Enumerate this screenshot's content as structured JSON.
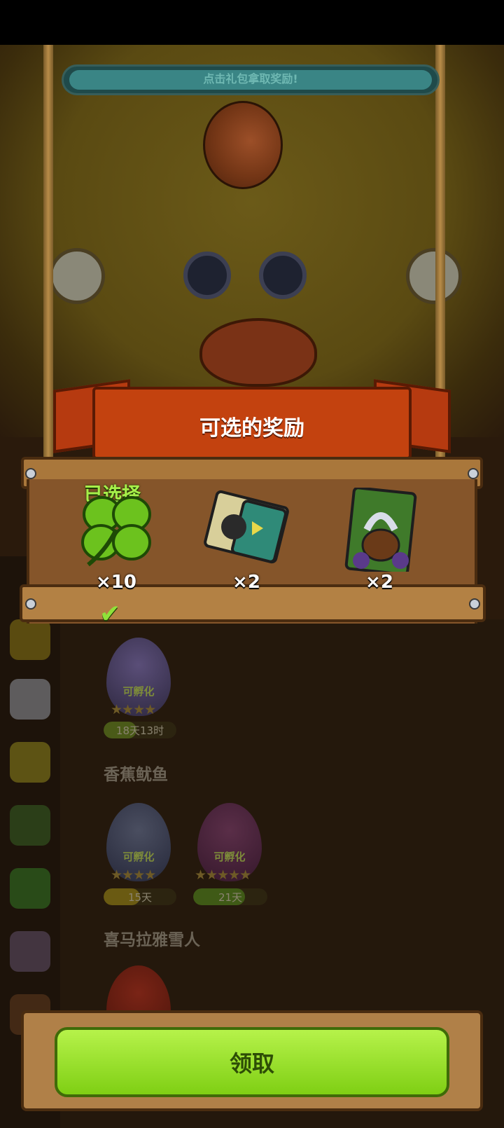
{
  "top_banner": {
    "text": "点击礼包拿取奖励!"
  },
  "panel": {
    "title": "可选的奖励",
    "selected_label": "已选择",
    "rewards": [
      {
        "name": "clover-icon",
        "count": "×10",
        "selected": true
      },
      {
        "name": "video-ticket-icon",
        "count": "×2",
        "selected": false
      },
      {
        "name": "cauldron-card-icon",
        "count": "×2",
        "selected": false
      }
    ]
  },
  "background_list": {
    "eggs_row1": [
      {
        "label": "可孵化",
        "stars": "★★★★",
        "timer": "18天13时",
        "progress": 0.45
      }
    ],
    "section1_title": "香蕉鱿鱼",
    "eggs_row2": [
      {
        "label": "可孵化",
        "stars": "★★★★",
        "timer": "15天",
        "progress": 0.5
      },
      {
        "label": "可孵化",
        "stars": "★★★★★",
        "timer": "21天",
        "progress": 0.7
      }
    ],
    "section2_title": "喜马拉雅雪人"
  },
  "claim_button": {
    "label": "领取"
  },
  "colors": {
    "accent_green": "#8fe23a",
    "ribbon": "#c3420f",
    "wood": "#a9773b"
  }
}
